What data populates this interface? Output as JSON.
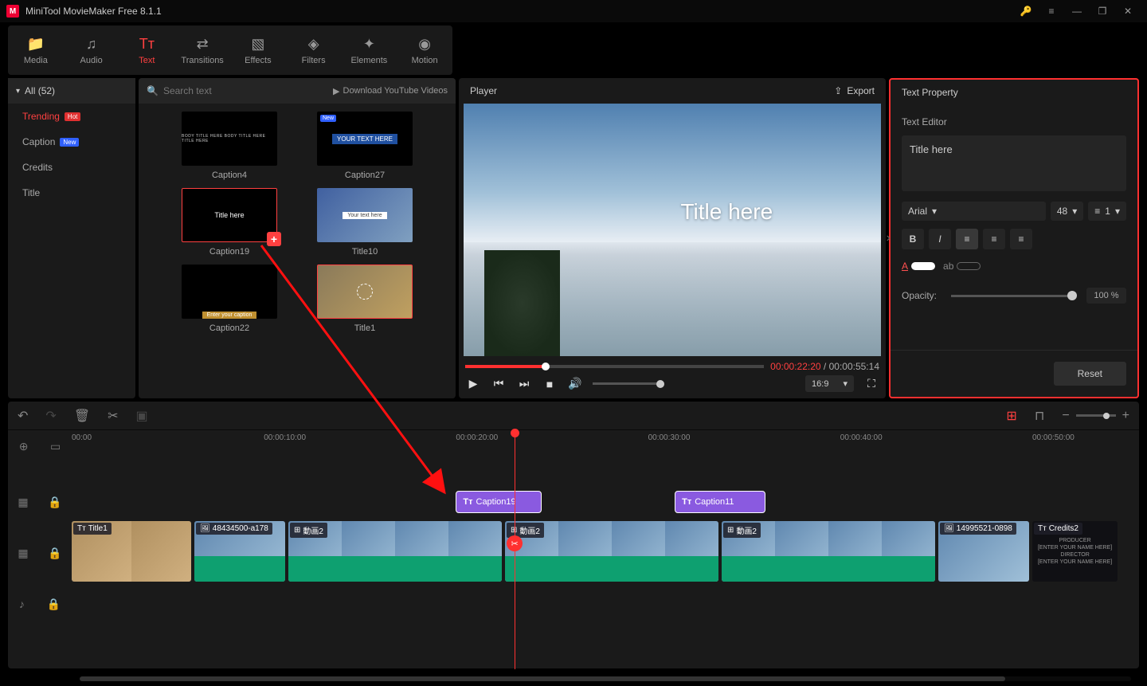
{
  "titlebar": {
    "app": "MiniTool MovieMaker Free 8.1.1"
  },
  "toptabs": {
    "media": "Media",
    "audio": "Audio",
    "text": "Text",
    "transitions": "Transitions",
    "effects": "Effects",
    "filters": "Filters",
    "elements": "Elements",
    "motion": "Motion"
  },
  "sidebar": {
    "all": "All (52)",
    "cats": {
      "trending": "Trending",
      "caption": "Caption",
      "credits": "Credits",
      "title": "Title"
    },
    "badges": {
      "hot": "Hot",
      "new": "New"
    }
  },
  "library": {
    "search_placeholder": "Search text",
    "download": "Download YouTube Videos",
    "items": {
      "r1c1": "Caption4",
      "r1c2": "Caption27",
      "r2c1": "Caption19",
      "r2c2": "Title10",
      "r3c1": "Caption22",
      "r3c2": "Title1"
    },
    "thumb_txt": {
      "c4": "",
      "c27": "YOUR TEXT HERE",
      "c19": "Title here",
      "t10": "Your text here"
    }
  },
  "player": {
    "label": "Player",
    "export": "Export",
    "overlay": "Title here",
    "time_cur": "00:00:22:20",
    "time_sep": " / ",
    "time_total": "00:00:55:14",
    "aspect": "16:9"
  },
  "props": {
    "title": "Text Property",
    "editor_label": "Text Editor",
    "text_value": "Title here",
    "font": "Arial",
    "size": "48",
    "lineheight": "1",
    "opacity_label": "Opacity:",
    "opacity_val": "100 %",
    "reset": "Reset"
  },
  "timeline": {
    "ruler": [
      "00:00",
      "00:00:10:00",
      "00:00:20:00",
      "00:00:30:00",
      "00:00:40:00",
      "00:00:50:00"
    ],
    "captions": {
      "c1": "Caption19",
      "c2": "Caption11"
    },
    "clips": {
      "title1": "Title1",
      "img1": "48434500-a178",
      "v1": "動画2",
      "v2": "動画2",
      "v3": "動画2",
      "img2": "14995521-0898",
      "credits": "Credits2"
    },
    "credits_lines": [
      "PRODUCER",
      "[ENTER YOUR NAME HERE]",
      "DIRECTOR",
      "[ENTER YOUR NAME HERE]"
    ]
  }
}
